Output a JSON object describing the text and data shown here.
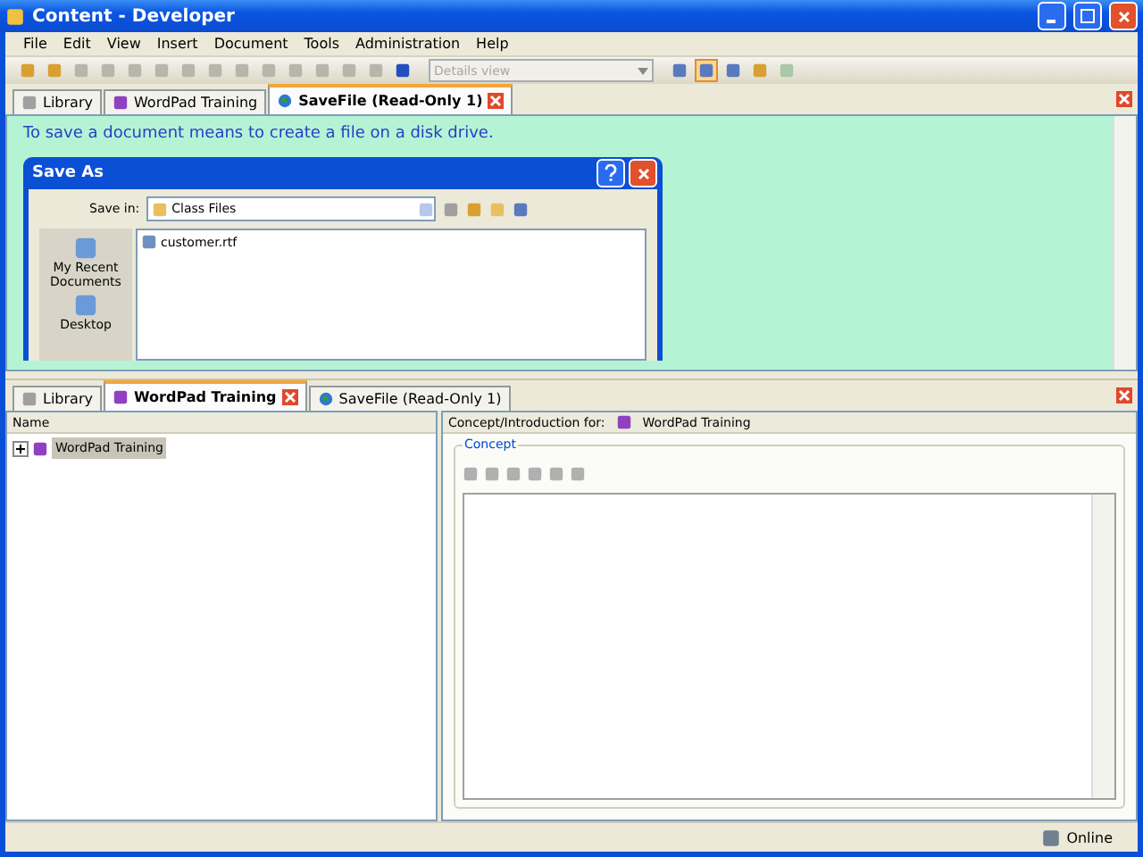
{
  "window": {
    "title": "Content - Developer"
  },
  "menu": [
    "File",
    "Edit",
    "View",
    "Insert",
    "Document",
    "Tools",
    "Administration",
    "Help"
  ],
  "toolbar": {
    "view_select": {
      "placeholder": "Details view",
      "disabled": true
    },
    "layout_buttons": [
      {
        "selected": false
      },
      {
        "selected": true
      },
      {
        "selected": false
      }
    ]
  },
  "top_tabs": [
    {
      "label": "Library",
      "kind": "library",
      "selected": false,
      "closable": false
    },
    {
      "label": "WordPad Training",
      "kind": "course",
      "selected": false,
      "closable": false
    },
    {
      "label": "SaveFile (Read-Only 1)",
      "kind": "web",
      "selected": true,
      "closable": true
    }
  ],
  "content": {
    "text": "To save a document means to create a file on a disk drive.",
    "dialog": {
      "title": "Save As",
      "save_in_label": "Save in:",
      "folder": "Class Files",
      "places": [
        "My Recent Documents",
        "Desktop"
      ],
      "files": [
        "customer.rtf"
      ]
    }
  },
  "bottom_tabs": [
    {
      "label": "Library",
      "kind": "library",
      "selected": false,
      "closable": false
    },
    {
      "label": "WordPad Training",
      "kind": "course",
      "selected": true,
      "closable": true
    },
    {
      "label": "SaveFile (Read-Only 1)",
      "kind": "web",
      "selected": false,
      "closable": false
    }
  ],
  "tree": {
    "column": "Name",
    "items": [
      {
        "label": "WordPad Training",
        "selected": true,
        "expanded": false
      }
    ]
  },
  "concept_panel": {
    "label": "Concept/Introduction for:",
    "title": "WordPad Training",
    "group": "Concept"
  },
  "status_bar": {
    "status": "Online"
  }
}
